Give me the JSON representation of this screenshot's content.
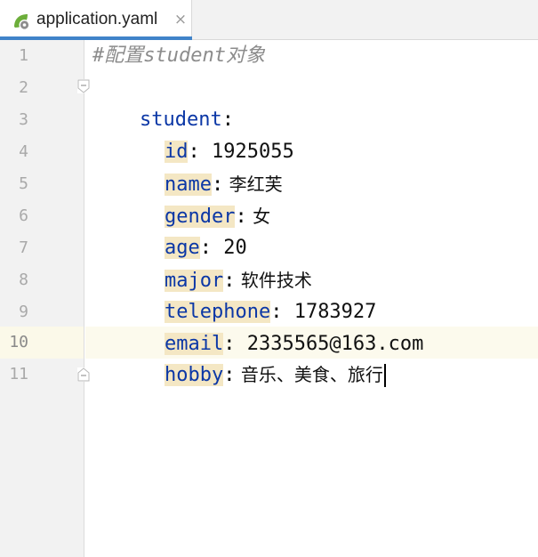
{
  "tab": {
    "title": "application.yaml",
    "close_glyph": "×",
    "icon": "leaf-settings-icon"
  },
  "editor": {
    "line_numbers": [
      "1",
      "2",
      "3",
      "4",
      "5",
      "6",
      "7",
      "8",
      "9",
      "10",
      "11"
    ],
    "current_line": "10",
    "lines": [
      {
        "text": "#配置student对象"
      },
      {
        "key": "student",
        "colon": ":"
      },
      {
        "key": "id",
        "colon": ":",
        "value": " 1925055"
      },
      {
        "key": "name",
        "colon": ":",
        "value": " 李红芙"
      },
      {
        "key": "gender",
        "colon": ":",
        "value": " 女"
      },
      {
        "key": "age",
        "colon": ":",
        "value": " 20"
      },
      {
        "key": "major",
        "colon": ":",
        "value": " 软件技术"
      },
      {
        "key": "telephone",
        "colon": ":",
        "value": " 1783927"
      },
      {
        "key": "email",
        "colon": ":",
        "value": " 2335565@163.com"
      },
      {
        "key": "hobby",
        "colon": ":",
        "value": " 音乐、美食、旅行"
      }
    ]
  },
  "colors": {
    "key": "#0b37a6",
    "comment": "#8c8c8c",
    "indent_highlight": "#f4e7c4",
    "current_line": "#fcfaed",
    "tab_underline": "#4083c9"
  }
}
